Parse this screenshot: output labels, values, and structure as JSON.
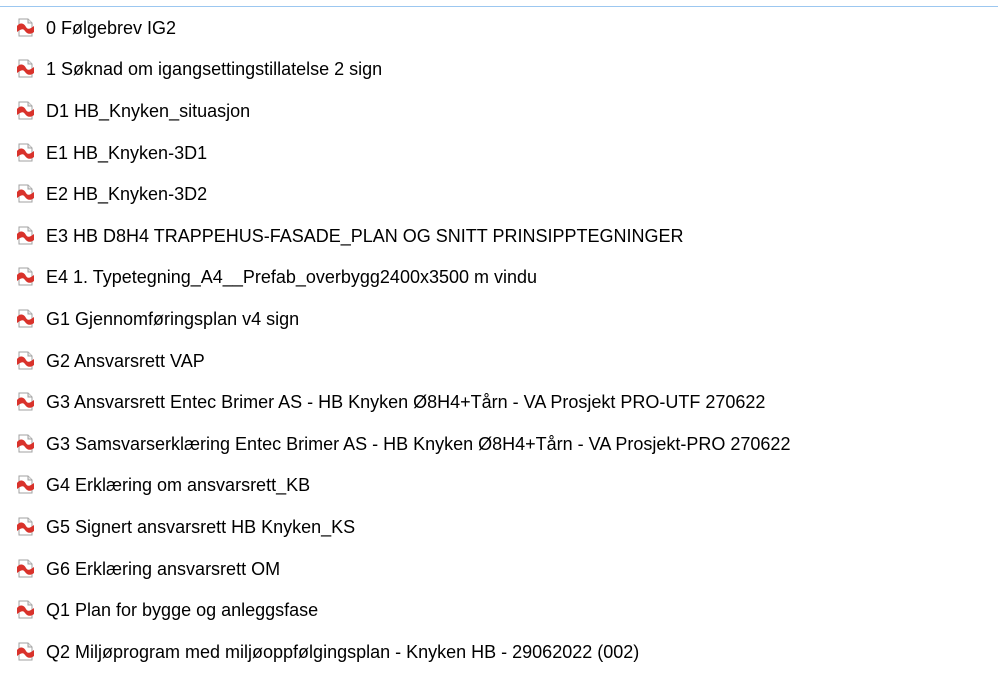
{
  "files": [
    {
      "name": "0 Følgebrev IG2",
      "icon": "pdf-file-icon"
    },
    {
      "name": "1 Søknad om igangsettingstillatelse 2 sign",
      "icon": "pdf-file-icon"
    },
    {
      "name": "D1 HB_Knyken_situasjon",
      "icon": "pdf-file-icon"
    },
    {
      "name": "E1 HB_Knyken-3D1",
      "icon": "pdf-file-icon"
    },
    {
      "name": "E2 HB_Knyken-3D2",
      "icon": "pdf-file-icon"
    },
    {
      "name": "E3 HB D8H4 TRAPPEHUS-FASADE_PLAN OG SNITT PRINSIPPTEGNINGER",
      "icon": "pdf-file-icon"
    },
    {
      "name": "E4 1. Typetegning_A4__Prefab_overbygg2400x3500 m vindu",
      "icon": "pdf-file-icon"
    },
    {
      "name": "G1 Gjennomføringsplan v4 sign",
      "icon": "pdf-file-icon"
    },
    {
      "name": "G2 Ansvarsrett VAP",
      "icon": "pdf-file-icon"
    },
    {
      "name": "G3 Ansvarsrett Entec Brimer AS - HB Knyken Ø8H4+Tårn - VA Prosjekt PRO-UTF 270622",
      "icon": "pdf-file-icon"
    },
    {
      "name": "G3 Samsvarserklæring Entec Brimer AS - HB Knyken Ø8H4+Tårn - VA Prosjekt-PRO 270622",
      "icon": "pdf-file-icon"
    },
    {
      "name": "G4 Erklæring om ansvarsrett_KB",
      "icon": "pdf-file-icon"
    },
    {
      "name": "G5 Signert ansvarsrett HB Knyken_KS",
      "icon": "pdf-file-icon"
    },
    {
      "name": "G6 Erklæring ansvarsrett OM",
      "icon": "pdf-file-icon"
    },
    {
      "name": "Q1 Plan for bygge og anleggsfase",
      "icon": "pdf-file-icon"
    },
    {
      "name": "Q2 Miljøprogram med miljøoppfølgingsplan - Knyken HB  - 29062022 (002)",
      "icon": "pdf-file-icon"
    }
  ],
  "colors": {
    "icon_red": "#d9322b",
    "icon_page": "#ffffff",
    "icon_border": "#a0a0a0",
    "selection_edge": "#9cc7f0"
  }
}
